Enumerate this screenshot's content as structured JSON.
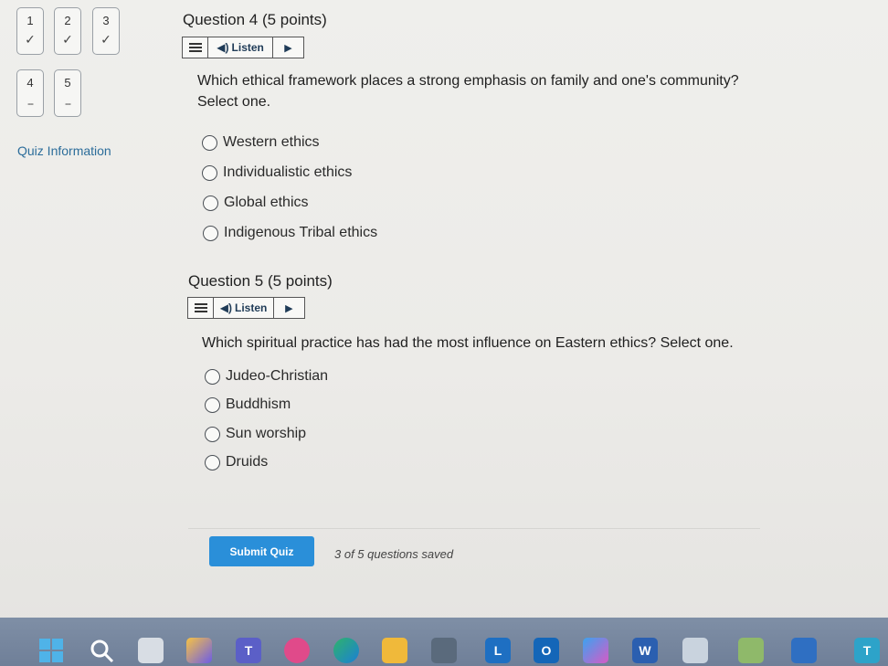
{
  "navigator": {
    "questions": [
      {
        "num": "1",
        "status": "✓"
      },
      {
        "num": "2",
        "status": "✓"
      },
      {
        "num": "3",
        "status": "✓"
      },
      {
        "num": "4",
        "status": "--"
      },
      {
        "num": "5",
        "status": "--"
      }
    ],
    "quiz_info": "Quiz Information"
  },
  "listen_label": "Listen",
  "q4": {
    "title": "Question 4 (5 points)",
    "prompt_line1": "Which ethical framework places a strong emphasis on family and one's community?",
    "prompt_line2": "Select one.",
    "options": [
      "Western ethics",
      "Individualistic ethics",
      "Global ethics",
      "Indigenous Tribal ethics"
    ]
  },
  "q5": {
    "title": "Question 5 (5 points)",
    "prompt": "Which spiritual practice has had the most influence on Eastern ethics? Select one.",
    "options": [
      "Judeo-Christian",
      "Buddhism",
      "Sun worship",
      "Druids"
    ]
  },
  "footer": {
    "submit_label": "Submit Quiz",
    "saved_status": "3 of 5 questions saved"
  },
  "taskbar": {
    "items": [
      "start-icon",
      "search-icon",
      "file-icon",
      "photos-icon",
      "teams-icon",
      "app-icon",
      "edge-icon",
      "folder-icon",
      "calculator-icon",
      "lockdown-browser-icon",
      "outlook-icon",
      "app-icon",
      "word-icon",
      "app-icon",
      "app-icon",
      "app-icon",
      "app-icon"
    ],
    "lockdown_letter": "L",
    "outlook_letter": "O",
    "word_letter": "W",
    "teams_letter": "T",
    "last_letter": "T"
  },
  "colors": {
    "link": "#2c6d9a",
    "submit": "#2a8fd9",
    "taskbar": "#7f8fa6"
  }
}
